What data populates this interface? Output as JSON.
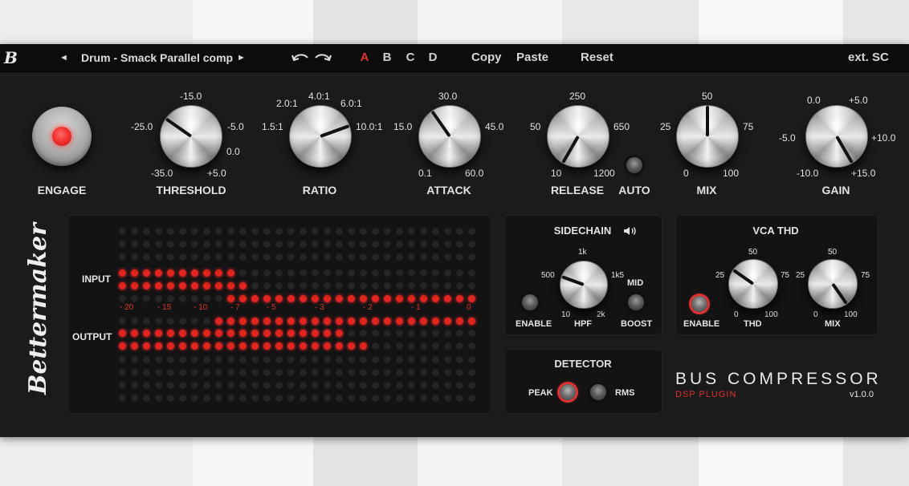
{
  "topbar": {
    "logo": "B",
    "prev_arrow": "◄",
    "preset_name": "Drum - Smack Parallel comp",
    "next_arrow": "►",
    "undo_icon": "undo-icon",
    "redo_icon": "redo-icon",
    "ab_slots": [
      "A",
      "B",
      "C",
      "D"
    ],
    "active_slot": "A",
    "copy": "Copy",
    "paste": "Paste",
    "reset": "Reset",
    "ext_sc": "ext. SC"
  },
  "engage": {
    "label": "ENGAGE"
  },
  "threshold": {
    "label": "THRESHOLD",
    "scale": [
      "-15.0",
      "-25.0",
      "-5.0",
      "0.0",
      "-35.0",
      "+5.0"
    ]
  },
  "ratio": {
    "label": "RATIO",
    "scale": [
      "4.0:1",
      "2.0:1",
      "6.0:1",
      "1.5:1",
      "10.0:1"
    ]
  },
  "attack": {
    "label": "ATTACK",
    "scale": [
      "30.0",
      "15.0",
      "45.0",
      "0.1",
      "60.0"
    ]
  },
  "release": {
    "label": "RELEASE",
    "scale": [
      "250",
      "50",
      "650",
      "10",
      "1200"
    ]
  },
  "auto": {
    "label": "AUTO"
  },
  "mix": {
    "label": "MIX",
    "scale": [
      "50",
      "25",
      "75",
      "0",
      "100"
    ]
  },
  "gain": {
    "label": "GAIN",
    "scale": [
      "0.0",
      "+5.0",
      "-5.0",
      "+10.0",
      "-10.0",
      "+15.0"
    ]
  },
  "brand": "Bettermaker",
  "meter": {
    "input_label": "INPUT",
    "output_label": "OUTPUT",
    "scale": [
      "- 20",
      "- 15",
      "- 10",
      "- 7",
      "- 5",
      "- 3",
      "- 2",
      "- 1",
      "0"
    ],
    "lit_color": "#e02520"
  },
  "sidechain": {
    "title": "SIDECHAIN",
    "speaker_icon": "speaker-icon",
    "hpf_scale": [
      "1k",
      "500",
      "1k5",
      "10",
      "2k"
    ],
    "hpf_label": "HPF",
    "enable_label": "ENABLE",
    "mid_label": "MID",
    "boost_label": "BOOST"
  },
  "vca_thd": {
    "title": "VCA THD",
    "enable_label": "ENABLE",
    "thd_label": "THD",
    "thd_scale": [
      "50",
      "25",
      "75",
      "0",
      "100"
    ],
    "mix_label": "MIX",
    "mix_scale": [
      "50",
      "25",
      "75",
      "0",
      "100"
    ]
  },
  "detector": {
    "title": "DETECTOR",
    "peak": "PEAK",
    "rms": "RMS"
  },
  "product": {
    "name": "BUS COMPRESSOR",
    "sub": "DSP PLUGIN",
    "version": "v1.0.0"
  },
  "colors": {
    "accent": "#e0322c",
    "panel": "#1b1b1c",
    "topbar": "#0c0c0d"
  }
}
